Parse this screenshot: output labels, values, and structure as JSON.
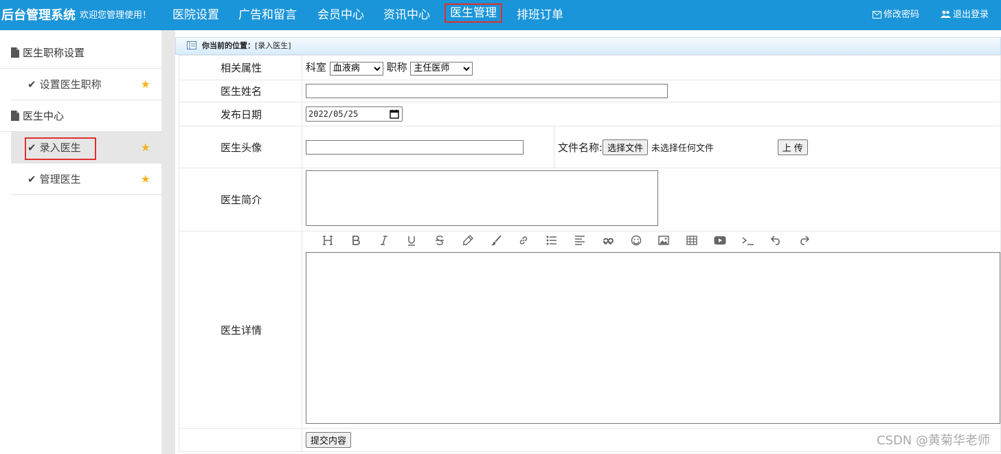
{
  "header": {
    "brand": "后台管理系统",
    "welcome": "欢迎您管理使用！",
    "nav": [
      {
        "label": "医院设置",
        "active": false
      },
      {
        "label": "广告和留言",
        "active": false
      },
      {
        "label": "会员中心",
        "active": false
      },
      {
        "label": "资讯中心",
        "active": false
      },
      {
        "label": "医生管理",
        "active": true
      },
      {
        "label": "排班订单",
        "active": false
      }
    ],
    "change_password": "修改密码",
    "logout": "退出登录"
  },
  "sidebar": {
    "groups": [
      {
        "title": "医生职称设置",
        "items": [
          {
            "label": "设置医生职称",
            "active": false
          }
        ]
      },
      {
        "title": "医生中心",
        "items": [
          {
            "label": "录入医生",
            "active": true
          },
          {
            "label": "管理医生",
            "active": false
          }
        ]
      }
    ]
  },
  "breadcrumb": {
    "prefix": "你当前的位置：",
    "current": "[录入医生]"
  },
  "form": {
    "attr_label": "相关属性",
    "dept_label": "科室",
    "dept_value": "血液病",
    "title_label": "职称",
    "title_value": "主任医师",
    "name_label": "医生姓名",
    "name_value": "",
    "date_label": "发布日期",
    "date_value": "2022/05/25",
    "avatar_label": "医生头像",
    "file_name_label": "文件名称:",
    "choose_file": "选择文件",
    "no_file": "未选择任何文件",
    "upload": "上 传",
    "intro_label": "医生简介",
    "detail_label": "医生详情",
    "submit": "提交内容"
  },
  "editor": {
    "tools": [
      "heading-icon",
      "bold-icon",
      "italic-icon",
      "underline-icon",
      "strikethrough-icon",
      "highlighter-icon",
      "brush-icon",
      "link-icon",
      "list-icon",
      "align-icon",
      "quote-icon",
      "emoji-icon",
      "image-icon",
      "table-icon",
      "video-icon",
      "code-icon",
      "undo-icon",
      "redo-icon"
    ]
  },
  "watermark": "CSDN @黄菊华老师",
  "colors": {
    "topbar": "#1b95d9",
    "highlight": "#e0302a",
    "star": "#f5b324"
  }
}
